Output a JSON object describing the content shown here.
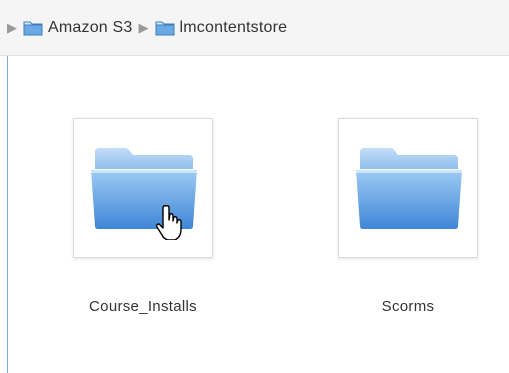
{
  "breadcrumb": {
    "items": [
      {
        "label": "Amazon S3",
        "icon": "folder-icon"
      },
      {
        "label": "lmcontentstore",
        "icon": "folder-icon"
      }
    ],
    "separator_icon": "triangle-right-icon"
  },
  "folders": [
    {
      "name": "Course_Installs",
      "icon": "folder-icon",
      "hovered": true
    },
    {
      "name": "Scorms",
      "icon": "folder-icon",
      "hovered": false
    }
  ],
  "colors": {
    "folder_light": "#a9d0f5",
    "folder_dark": "#4a8ed8",
    "breadcrumb_bg": "#f5f5f5",
    "text": "#333333"
  }
}
